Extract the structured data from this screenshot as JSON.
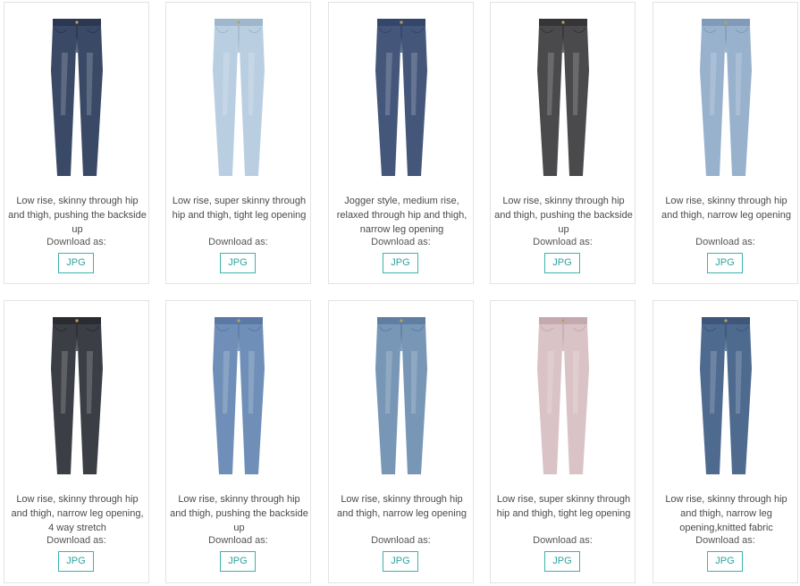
{
  "download_label": "Download as:",
  "format_label": "JPG",
  "accent_color": "#3bb3ae",
  "products": [
    {
      "description": "Low rise, skinny through hip and thigh, pushing the backside up",
      "image": "jeans-dark-blue",
      "wash": "#3a4a66",
      "shade": "#2c3852"
    },
    {
      "description": "Low rise, super skinny through hip and thigh, tight leg opening",
      "image": "jeans-light-blue",
      "wash": "#b9cfe1",
      "shade": "#9fb7cc"
    },
    {
      "description": "Jogger style, medium rise, relaxed through hip and thigh, narrow leg opening",
      "image": "jeans-jogger-blue",
      "wash": "#44577a",
      "shade": "#34466a"
    },
    {
      "description": "Low rise, skinny through hip and thigh, pushing the backside up",
      "image": "jeans-black",
      "wash": "#4a4a4c",
      "shade": "#353537"
    },
    {
      "description": "Low rise, skinny through hip and thigh, narrow leg opening",
      "image": "jeans-bleached-blue",
      "wash": "#98b1cc",
      "shade": "#7f9bb9"
    },
    {
      "description": "Low rise, skinny through hip and thigh, narrow leg opening, 4 way stretch",
      "image": "jeans-black-stretch",
      "wash": "#3b3e45",
      "shade": "#2a2c31"
    },
    {
      "description": "Low rise, skinny through hip and thigh, pushing the backside up",
      "image": "jeans-mid-blue",
      "wash": "#6f8fb8",
      "shade": "#5a7aa5"
    },
    {
      "description": "Low rise, skinny through hip and thigh, narrow leg opening",
      "image": "jeans-faded-blue",
      "wash": "#7896b5",
      "shade": "#5f7fa2"
    },
    {
      "description": "Low rise, super skinny through hip and thigh, tight leg opening",
      "image": "jeans-pink",
      "wash": "#d9c3c6",
      "shade": "#c4aaae"
    },
    {
      "description": "Low rise, skinny through hip and thigh, narrow leg opening,knitted fabric",
      "image": "jeans-knit-blue",
      "wash": "#4f6a8f",
      "shade": "#3d5679"
    }
  ]
}
